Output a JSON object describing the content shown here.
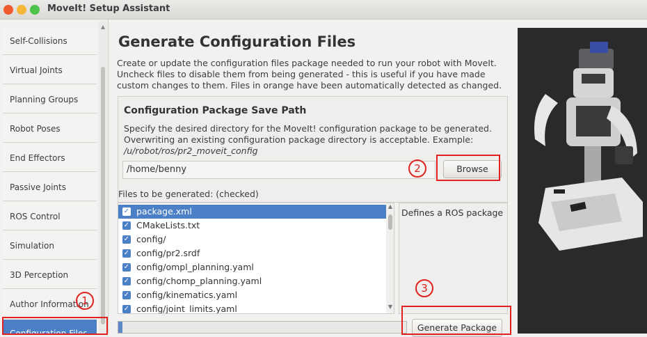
{
  "window": {
    "title": "MoveIt! Setup Assistant"
  },
  "sidebar": {
    "items": [
      {
        "label": "Self-Collisions",
        "active": false
      },
      {
        "label": "Virtual Joints",
        "active": false
      },
      {
        "label": "Planning Groups",
        "active": false
      },
      {
        "label": "Robot Poses",
        "active": false
      },
      {
        "label": "End Effectors",
        "active": false
      },
      {
        "label": "Passive Joints",
        "active": false
      },
      {
        "label": "ROS Control",
        "active": false
      },
      {
        "label": "Simulation",
        "active": false
      },
      {
        "label": "3D Perception",
        "active": false
      },
      {
        "label": "Author Information",
        "active": false
      },
      {
        "label": "Configuration Files",
        "active": true
      }
    ]
  },
  "main": {
    "title": "Generate Configuration Files",
    "description": "Create or update the configuration files package needed to run your robot with MoveIt. Uncheck files to disable them from being generated - this is useful if you have made custom changes to them. Files in orange have been automatically detected as changed.",
    "save_path": {
      "title": "Configuration Package Save Path",
      "description": "Specify the desired directory for the MoveIt! configuration package to be generated. Overwriting an existing configuration package directory is acceptable. Example: ",
      "example": "/u/robot/ros/pr2_moveit_config",
      "value": "/home/benny",
      "browse_label": "Browse"
    },
    "files_label": "Files to be generated: (checked)",
    "files": [
      {
        "name": "package.xml",
        "checked": true,
        "selected": true
      },
      {
        "name": "CMakeLists.txt",
        "checked": true,
        "selected": false
      },
      {
        "name": "config/",
        "checked": true,
        "selected": false
      },
      {
        "name": "config/pr2.srdf",
        "checked": true,
        "selected": false
      },
      {
        "name": "config/ompl_planning.yaml",
        "checked": true,
        "selected": false
      },
      {
        "name": "config/chomp_planning.yaml",
        "checked": true,
        "selected": false
      },
      {
        "name": "config/kinematics.yaml",
        "checked": true,
        "selected": false
      },
      {
        "name": "config/joint_limits.yaml",
        "checked": true,
        "selected": false
      }
    ],
    "file_description": "Defines a ROS package",
    "generate_label": "Generate Package"
  },
  "annotations": [
    "1",
    "2",
    "3"
  ],
  "colors": {
    "accent": "#4b7fc6",
    "annotation": "#e0211f"
  }
}
